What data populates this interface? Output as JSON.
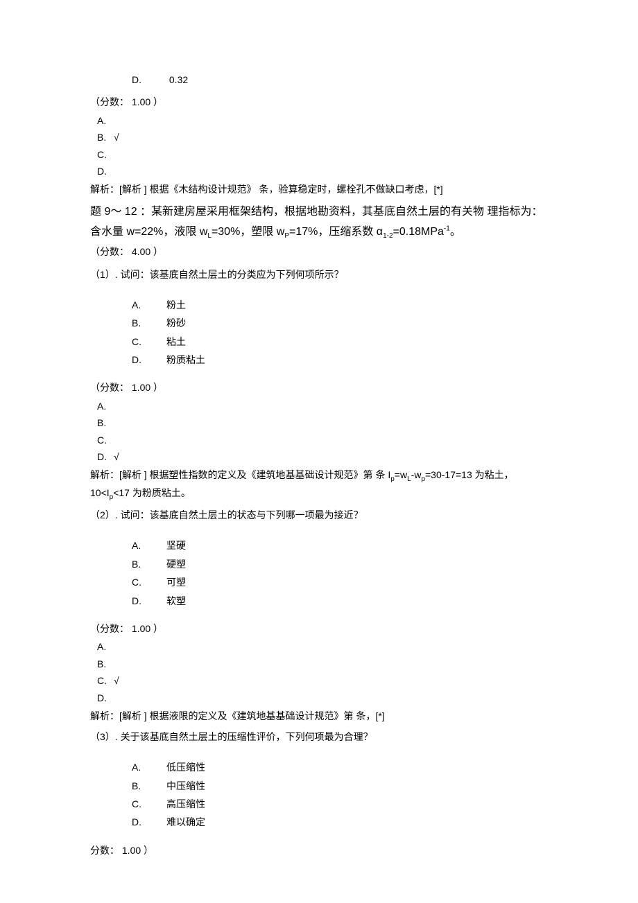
{
  "q8": {
    "optD_letter": "D.",
    "optD_text": "0.32",
    "score": "（分数： 1.00 ）",
    "ans": {
      "A": "A.",
      "B": "B.",
      "C": "C.",
      "D": "D."
    },
    "correctMark": "√",
    "analysis": "解析：[解析 ] 根据《木结构设计规范》 条，验算稳定时，螺栓孔不做缺口考虑，[*]"
  },
  "group": {
    "title_prefix": "题 9～ 12 ：",
    "title_body": "某新建房屋采用框架结构，根据地勘资料，其基底自然土层的有关物 理指标为： 含水量 w=22%，液限 w",
    "title_body2": "=30%，塑限 w",
    "title_body3": "=17%，压缩系数 α",
    "title_body4": "=0.18MPa",
    "title_body5": "。",
    "sub_L": "L",
    "sub_P": "P",
    "sub_12": "1-2",
    "sup_neg1": "-1",
    "score": "（分数： 4.00 ）"
  },
  "q1": {
    "stem": "（1）. 试问：该基底自然土层土的分类应为下列何项所示？",
    "opts": {
      "A": {
        "l": "A.",
        "t": "粉土"
      },
      "B": {
        "l": "B.",
        "t": "粉砂"
      },
      "C": {
        "l": "C.",
        "t": "粘土"
      },
      "D": {
        "l": "D.",
        "t": "粉质粘土"
      }
    },
    "score": "（分数： 1.00 ）",
    "ans": {
      "A": "A.",
      "B": "B.",
      "C": "C.",
      "D": "D."
    },
    "correctMark": "√",
    "analysis_a": "解析：[解析 ] 根据塑性指数的定义及《建筑地基基础设计规范》第 条 I",
    "analysis_b": "=w",
    "analysis_c": "-w",
    "analysis_d": "=30-17=13 为粘土， 10<I",
    "analysis_e": "<17 为粉质粘土。",
    "sub_p": "p",
    "sub_L": "L",
    "sub_pcap": "P"
  },
  "q2": {
    "stem": "（2）. 试问：该基底自然土层土的状态与下列哪一项最为接近？",
    "opts": {
      "A": {
        "l": "A.",
        "t": "坚硬"
      },
      "B": {
        "l": "B.",
        "t": "硬塑"
      },
      "C": {
        "l": "C.",
        "t": "可塑"
      },
      "D": {
        "l": "D.",
        "t": "软塑"
      }
    },
    "score": "（分数： 1.00 ）",
    "ans": {
      "A": "A.",
      "B": "B.",
      "C": "C.",
      "D": "D."
    },
    "correctMark": "√",
    "analysis": "解析：[解析 ] 根据液限的定义及《建筑地基基础设计规范》第 条，[*]"
  },
  "q3": {
    "stem": "（3）. 关于该基底自然土层土的压缩性评价，下列何项最为合理？",
    "opts": {
      "A": {
        "l": "A.",
        "t": "低压缩性"
      },
      "B": {
        "l": "B.",
        "t": "中压缩性"
      },
      "C": {
        "l": "C.",
        "t": "高压缩性"
      },
      "D": {
        "l": "D.",
        "t": "难以确定"
      }
    },
    "score": " 分数： 1.00 ）"
  }
}
